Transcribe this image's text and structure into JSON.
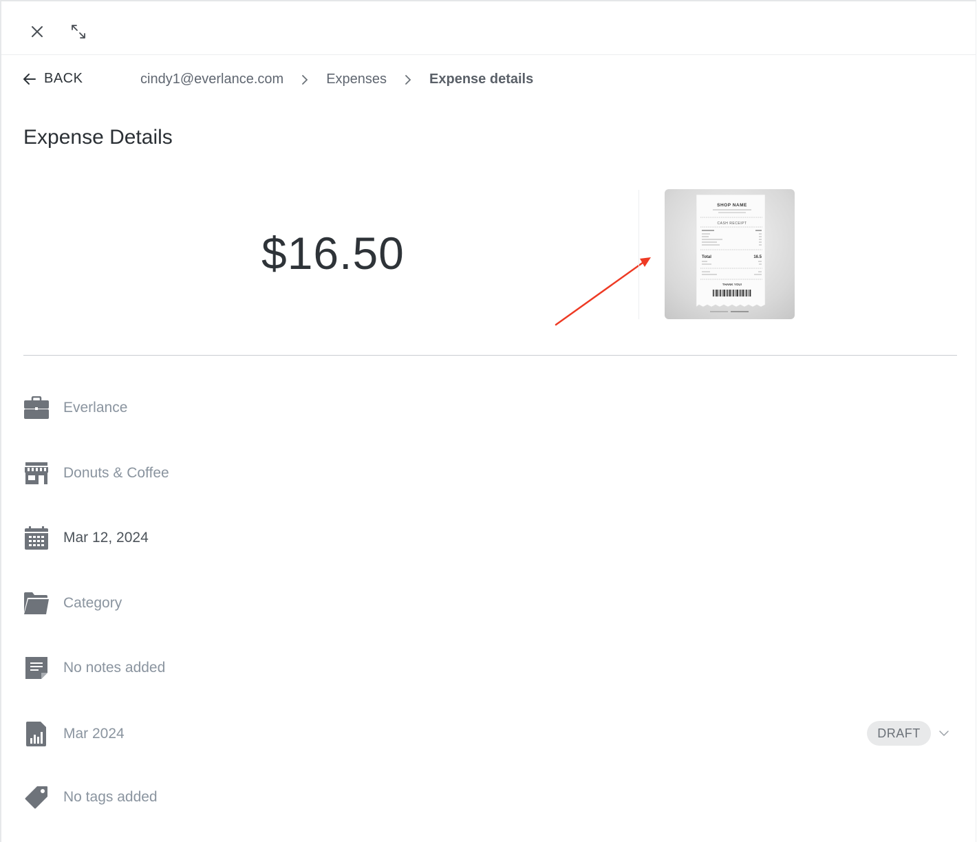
{
  "window": {
    "close_icon": "close-icon",
    "expand_icon": "expand-icon"
  },
  "nav": {
    "back_label": "BACK",
    "breadcrumbs": [
      "cindy1@everlance.com",
      "Expenses",
      "Expense details"
    ]
  },
  "page": {
    "title": "Expense Details"
  },
  "expense": {
    "amount": "$16.50",
    "receipt": {
      "shop_name": "SHOP NAME",
      "heading": "CASH RECEIPT",
      "total_label": "Total",
      "total_value": "16.5",
      "thanks": "THANK YOU!"
    }
  },
  "details": [
    {
      "icon": "briefcase-icon",
      "label": "Everlance"
    },
    {
      "icon": "store-icon",
      "label": "Donuts & Coffee"
    },
    {
      "icon": "calendar-icon",
      "label": "Mar 12, 2024"
    },
    {
      "icon": "folder-icon",
      "label": "Category"
    },
    {
      "icon": "note-icon",
      "label": "No notes added"
    },
    {
      "icon": "report-icon",
      "label": "Mar 2024"
    },
    {
      "icon": "tag-icon",
      "label": "No tags added"
    }
  ],
  "report": {
    "status": "DRAFT"
  },
  "colors": {
    "icon": "#6e737a",
    "placeholder_text": "#8a949f",
    "annotation_arrow": "#ee3a24"
  }
}
